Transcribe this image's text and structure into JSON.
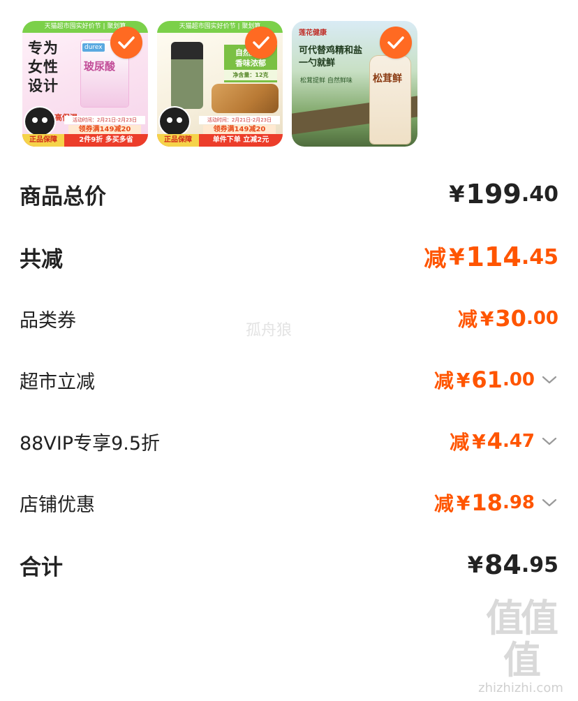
{
  "products": [
    {
      "top_banner": "天猫超市囤实好价节 | 聚划算",
      "headline": [
        "专为",
        "女性",
        "设计"
      ],
      "sub": "高保湿",
      "pack_brand": "durex",
      "pack_text": "玻尿酸",
      "date": "活动时间：2月21日-2月23日",
      "coupon": "领券满149减20",
      "left_tag": "正品保障",
      "right_tag": "2件9折 多买多省"
    },
    {
      "top_banner": "天猫超市囤实好价节 | 聚划算",
      "tag_title": "自然原香",
      "tag_sub": "香味浓郁",
      "net": "净含量：12克",
      "date": "活动时间：2月21日-2月23日",
      "coupon": "领券满149减20",
      "left_tag": "正品保障",
      "right_tag": "单件下单 立减2元"
    },
    {
      "brand": "莲花健康",
      "headline1": "可代替鸡精和盐",
      "headline2": "一勺就鲜",
      "sub": "松茸提鲜 自然鲜味",
      "bottle_label": "松茸鲜"
    }
  ],
  "summary": {
    "total_label": "商品总价",
    "total_yen": "¥",
    "total_int": "199",
    "total_dec": ".40",
    "reduce_label": "共减",
    "reduce_prefix": "减",
    "reduce_yen": "¥",
    "reduce_int": "114",
    "reduce_dec": ".45",
    "items": [
      {
        "label": "品类券",
        "prefix": "减",
        "yen": "¥",
        "int": "30",
        "dec": ".00",
        "expandable": false
      },
      {
        "label": "超市立减",
        "prefix": "减",
        "yen": "¥",
        "int": "61",
        "dec": ".00",
        "expandable": true
      },
      {
        "label": "88VIP专享9.5折",
        "prefix": "减",
        "yen": "¥",
        "int": "4",
        "dec": ".47",
        "expandable": true
      },
      {
        "label": "店铺优惠",
        "prefix": "减",
        "yen": "¥",
        "int": "18",
        "dec": ".98",
        "expandable": true
      }
    ],
    "grand_label": "合计",
    "grand_yen": "¥",
    "grand_int": "84",
    "grand_dec": ".95"
  },
  "watermark": "孤舟狼",
  "site_logo": {
    "big": "值值值",
    "small": "zhizhizhi.com"
  },
  "colors": {
    "accent": "#ff5500",
    "check": "#ff6a22"
  }
}
